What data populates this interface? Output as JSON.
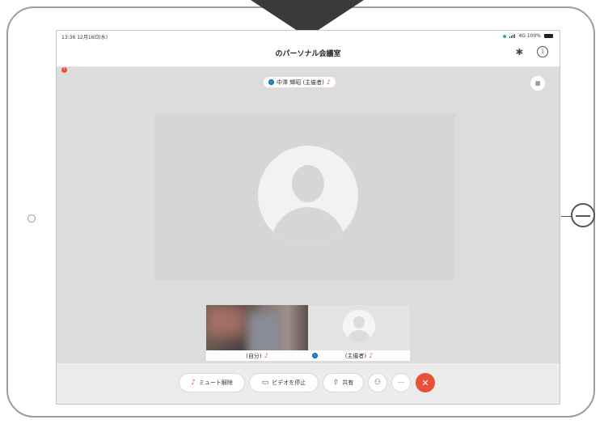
{
  "status_bar": {
    "time_date": "13:36  12月16日(水)",
    "network": "4G 100%"
  },
  "meeting": {
    "title": "のパーソナル会議室",
    "active_speaker_label": "中澤 輝昭 (主催者)"
  },
  "self_tile": {
    "label": "(自分)"
  },
  "host_tile": {
    "label": "(主催者)"
  },
  "toolbar": {
    "mute_label": "ミュート解除",
    "video_label": "ビデオを停止",
    "share_label": "共有",
    "more_label": "···",
    "end_label": "✕"
  },
  "colors": {
    "end_call": "#e8503a",
    "webex_blue": "#1a8fd4",
    "muted_red": "#e8503a"
  },
  "icons": [
    "bluetooth-icon",
    "info-icon",
    "layout-grid-icon",
    "mic-muted-icon",
    "video-icon",
    "share-icon",
    "participants-icon",
    "more-icon",
    "end-call-icon"
  ]
}
